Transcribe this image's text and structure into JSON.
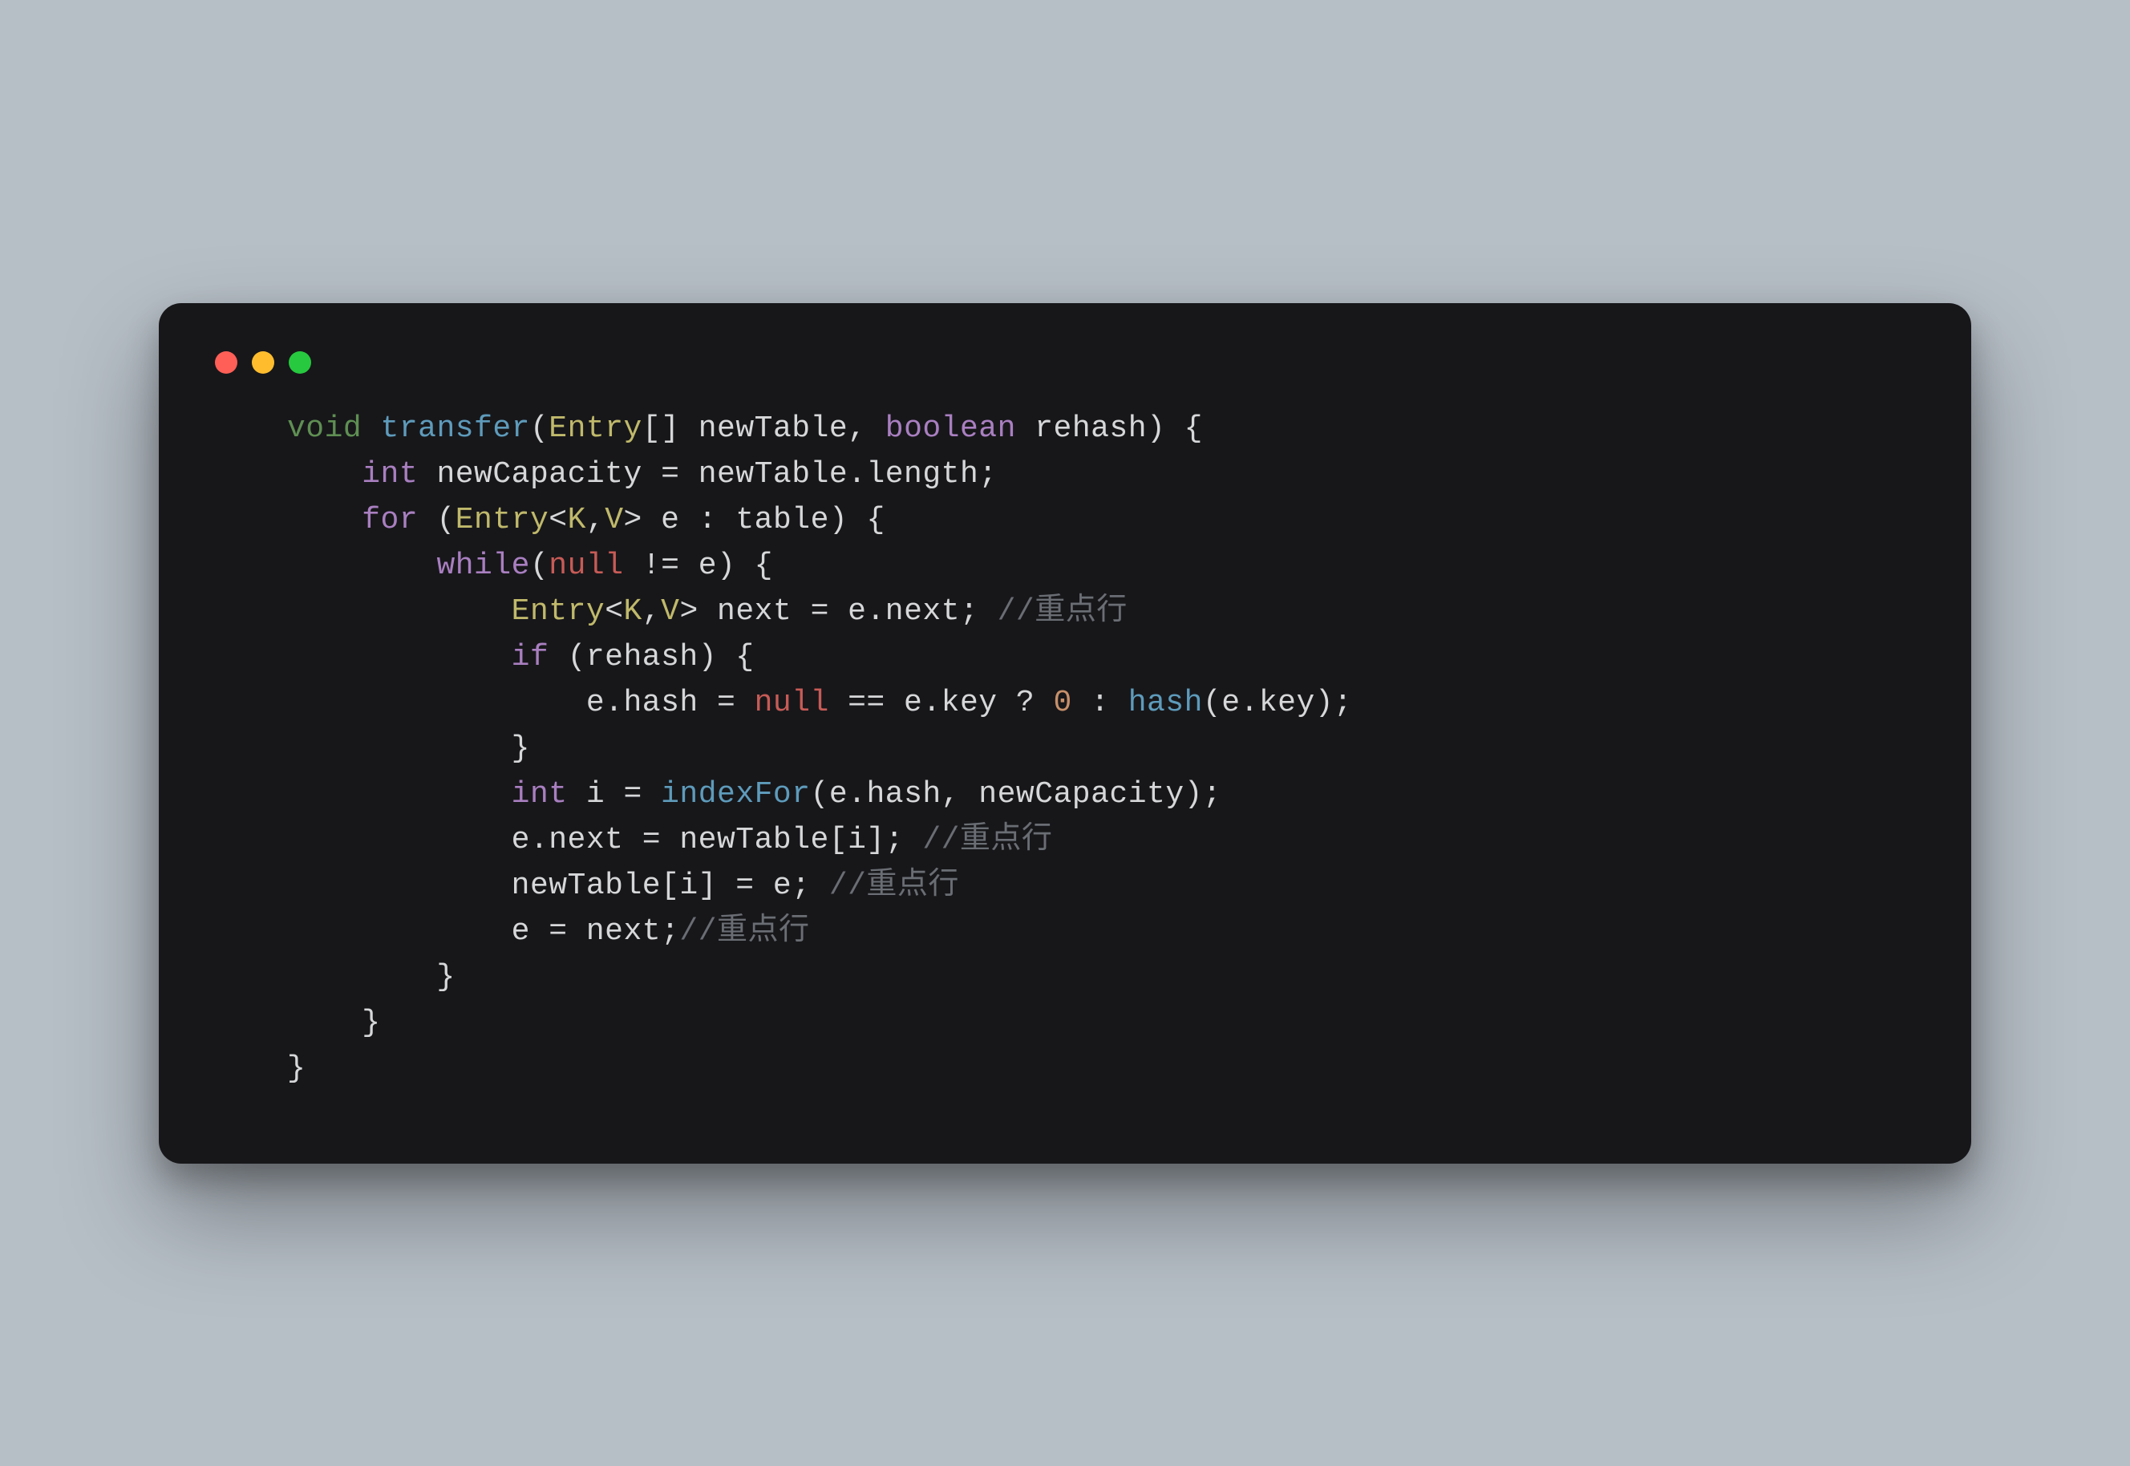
{
  "code": {
    "l1_void": "void",
    "l1_transfer": "transfer",
    "l1_p1": "(",
    "l1_entry": "Entry",
    "l1_brackets": "[]",
    "l1_nt": " newTable",
    "l1_comma": ", ",
    "l1_boolean": "boolean",
    "l1_rehash": " rehash",
    "l1_p2": ") {",
    "l2_indent": "    ",
    "l2_int": "int",
    "l2_rest": " newCapacity = newTable.length;",
    "l3_indent": "    ",
    "l3_for": "for",
    "l3_p1": " (",
    "l3_entry": "Entry",
    "l3_lt": "<",
    "l3_k": "K",
    "l3_c": ",",
    "l3_v": "V",
    "l3_gt": ">",
    "l3_tail": " e : table) {",
    "l4_indent": "        ",
    "l4_while": "while",
    "l4_p1": "(",
    "l4_null": "null",
    "l4_tail": " != e) {",
    "l5_indent": "            ",
    "l5_entry": "Entry",
    "l5_lt": "<",
    "l5_k": "K",
    "l5_c": ",",
    "l5_v": "V",
    "l5_gt": ">",
    "l5_tail": " next = e.next; ",
    "l5_comment": "//重点行",
    "l6_indent": "            ",
    "l6_if": "if",
    "l6_tail": " (rehash) {",
    "l7_indent": "                ",
    "l7_a": "e.hash = ",
    "l7_null": "null",
    "l7_b": " == e.key ? ",
    "l7_zero": "0",
    "l7_c": " : ",
    "l7_hash": "hash",
    "l7_d": "(e.key);",
    "l8": "            }",
    "l9_indent": "            ",
    "l9_int": "int",
    "l9_a": " i = ",
    "l9_fn": "indexFor",
    "l9_b": "(e.hash, newCapacity);",
    "l10_text": "            e.next = newTable[i]; ",
    "l10_comment": "//重点行",
    "l11_text": "            newTable[i] = e; ",
    "l11_comment": "//重点行",
    "l12_text": "            e = next;",
    "l12_comment": "//重点行",
    "l13": "        }",
    "l14": "    }",
    "l15": "}"
  }
}
